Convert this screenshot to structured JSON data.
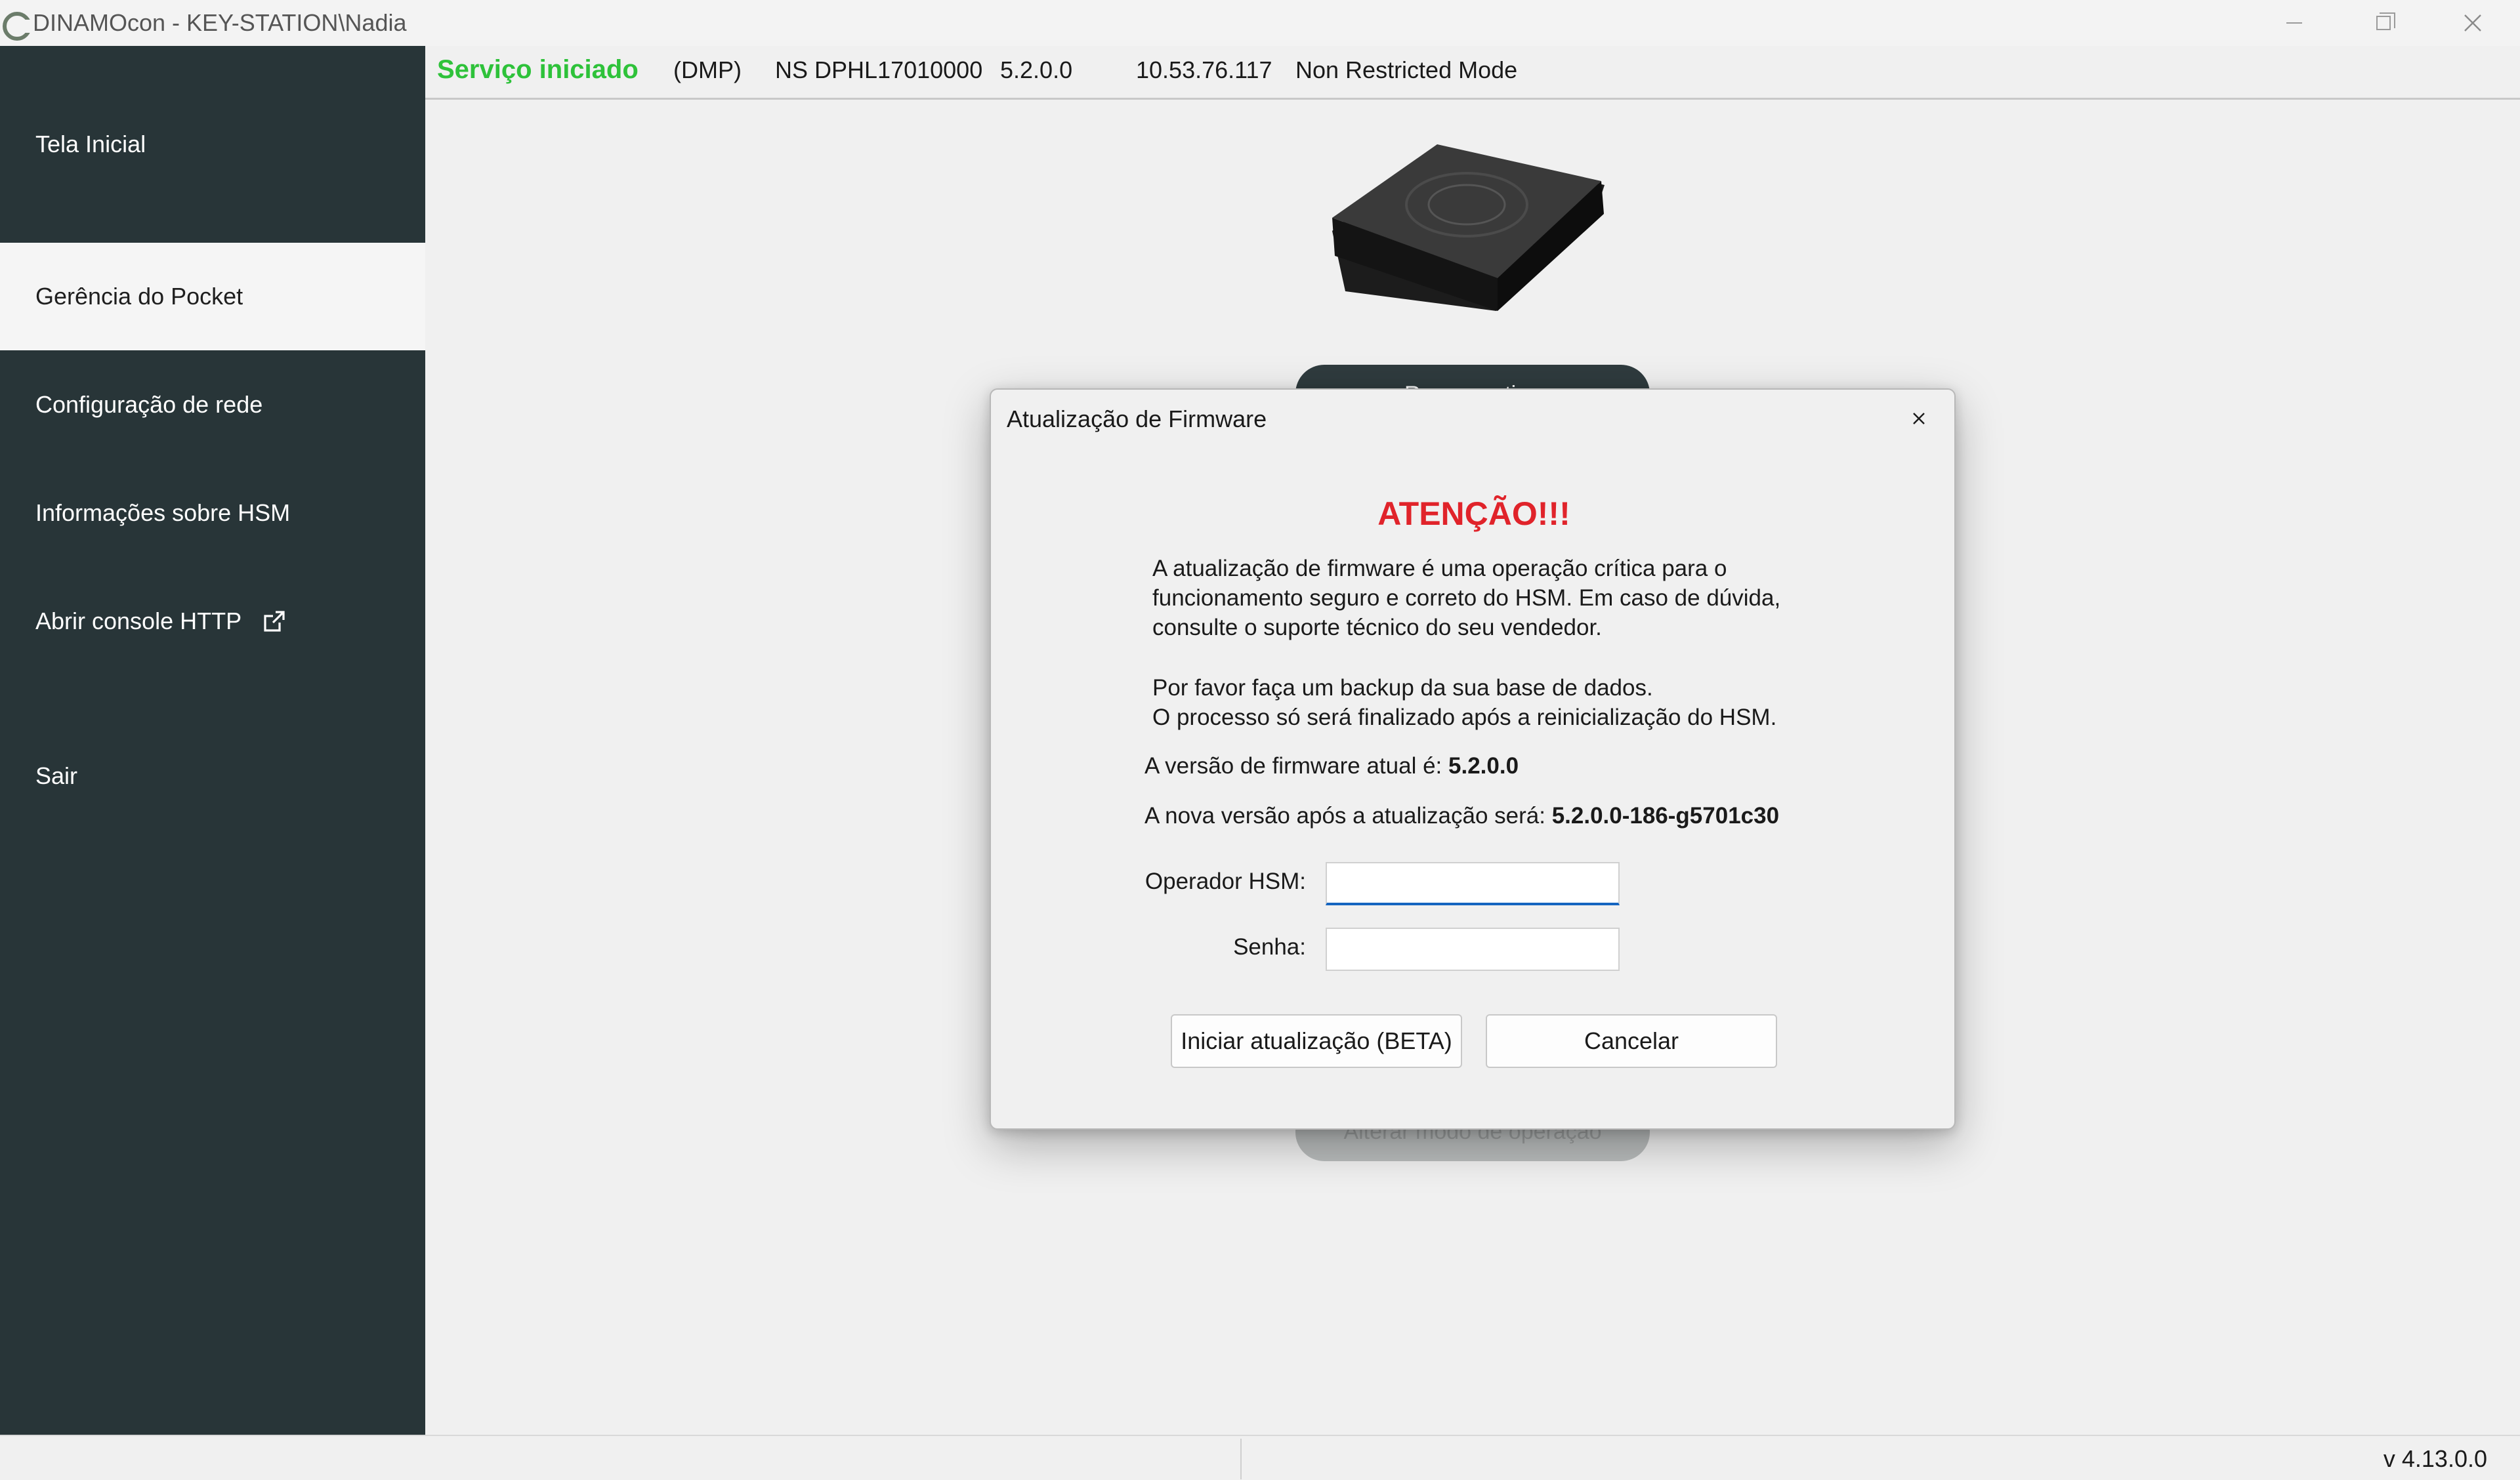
{
  "window": {
    "title": "DINAMOcon - KEY-STATION\\Nadia"
  },
  "sidebar": {
    "items": [
      {
        "label": "Tela Inicial",
        "active": false
      },
      {
        "label": "Gerência do Pocket",
        "active": true
      },
      {
        "label": "Configuração de rede",
        "active": false
      },
      {
        "label": "Informações sobre HSM",
        "active": false
      },
      {
        "label": "Abrir console HTTP",
        "active": false,
        "icon": "external-link-icon"
      },
      {
        "label": "Sair",
        "active": false
      }
    ]
  },
  "status": {
    "service": "Serviço iniciado",
    "service_color": "#2ec23a",
    "type": "(DMP)",
    "serial": "NS DPHL17010000",
    "firmware": "5.2.0.0",
    "ip": "10.53.76.117",
    "mode": "Non Restricted Mode"
  },
  "background_buttons": {
    "top_label": "Reconnecting",
    "bottom_label": "Alterar modo de operação"
  },
  "dialog": {
    "title": "Atualização de Firmware",
    "warning": "ATENÇÃO!!!",
    "warning_color": "#e0232a",
    "paragraph1": "A atualização de firmware é uma operação crítica para o funcionamento seguro e correto do HSM. Em caso de dúvida, consulte o suporte técnico do seu vendedor.",
    "paragraph2_line1": "Por favor faça um backup da sua base de dados.",
    "paragraph2_line2": "O processo só será finalizado após a reinicialização do HSM.",
    "current_version_label": "A versão de firmware atual é:",
    "current_version": "5.2.0.0",
    "new_version_label": "A nova versão após a atualização será:",
    "new_version": "5.2.0.0-186-g5701c30",
    "operator_label": "Operador HSM:",
    "operator_value": "",
    "password_label": "Senha:",
    "password_value": "",
    "start_button": "Iniciar atualização (BETA)",
    "cancel_button": "Cancelar"
  },
  "footer": {
    "version": "v 4.13.0.0"
  }
}
